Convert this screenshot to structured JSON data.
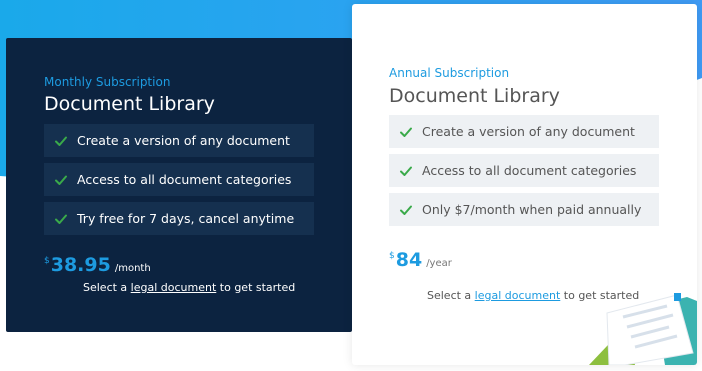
{
  "colors": {
    "accent": "#1d9be0",
    "monthly_background": "#0c2340",
    "check": "#3aaa4a",
    "annual_feature_background": "#eef1f4"
  },
  "monthly": {
    "eyebrow": "Monthly Subscription",
    "title": "Document Library",
    "features": [
      "Create a version of any document",
      "Access to all document categories",
      "Try free for 7 days, cancel anytime"
    ],
    "price": {
      "currency": "$",
      "amount": "38.95",
      "period": "/month"
    },
    "cta": {
      "before": "Select a ",
      "link": "legal document",
      "after": " to get started"
    }
  },
  "annual": {
    "eyebrow": "Annual Subscription",
    "title": "Document Library",
    "features": [
      "Create a version of any document",
      "Access to all document categories",
      "Only $7/month when paid annually"
    ],
    "price": {
      "currency": "$",
      "amount": "84",
      "period": "/year"
    },
    "cta": {
      "before": "Select a ",
      "link": "legal document",
      "after": " to get started"
    }
  }
}
